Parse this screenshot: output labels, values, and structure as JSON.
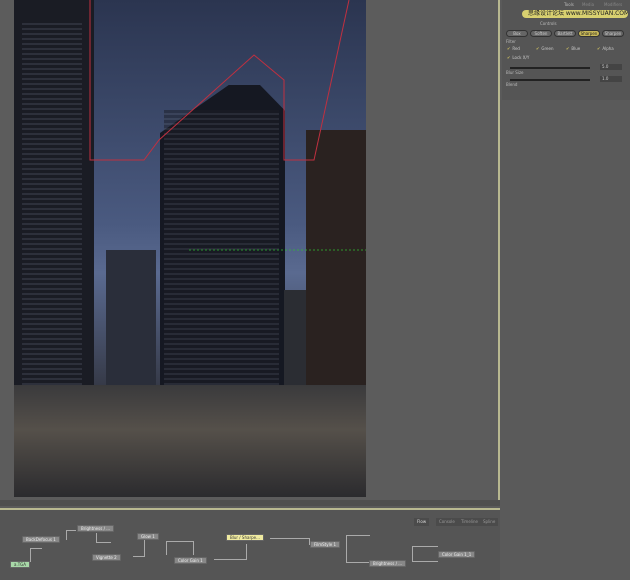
{
  "right_panel": {
    "tabs": [
      "Tools",
      "Media",
      "Modifiers"
    ],
    "watermark": "思缘设计论坛 www.MISSYUAN.COM",
    "section": "Controls",
    "filter_buttons": [
      "Box",
      "Soften",
      "Bartlett",
      "Sharpen",
      "Sharpen"
    ],
    "filter_selected": "Sharpen",
    "filter_label": "Filter",
    "channels": [
      "Red",
      "Green",
      "Blue",
      "Alpha"
    ],
    "lock_xy": "Lock X/Y",
    "blur_value": "5.0",
    "blur_size_label": "Blur Size",
    "blur_size_value": "1.0",
    "blend_label": "Blend"
  },
  "flow": {
    "tabs": [
      "Flow",
      "Console",
      "Timeline",
      "Spline"
    ],
    "nodes": {
      "bkdefocus": "BackDefocus 1",
      "tga": "a.TGA",
      "brightness1": "Brightness / ...",
      "vignette": "Vignette 2",
      "glow": "Glow 1",
      "colorgain1": "Color Gain 1",
      "blur": "Blur / Sharpe...",
      "filmstyle": "FilmStyle 1",
      "brightness2": "Brightness / ...",
      "colorgain2": "Color Gain 1_1"
    }
  },
  "colors": {
    "accent": "#b8b890",
    "selected_node": "#f0eba0",
    "loader_node": "#a8d8a8"
  }
}
